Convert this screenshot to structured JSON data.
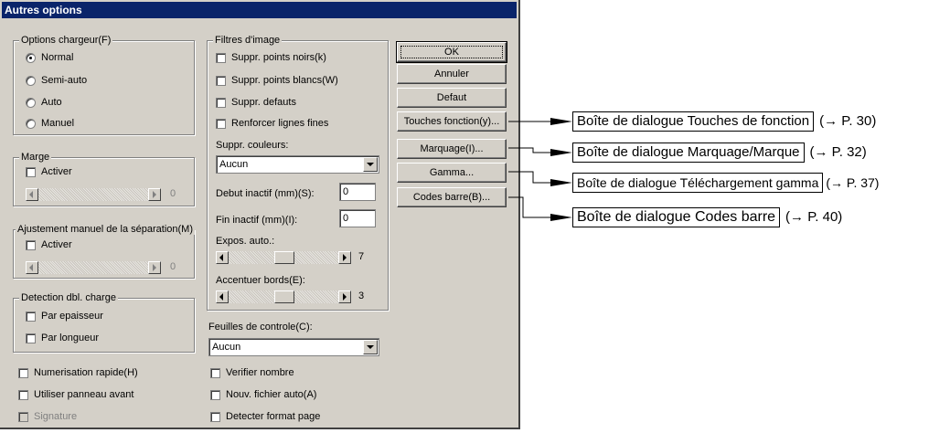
{
  "title": "Autres options",
  "loader": {
    "legend": "Options chargeur(F)",
    "options": [
      "Normal",
      "Semi-auto",
      "Auto",
      "Manuel"
    ],
    "selected": "Normal"
  },
  "margin": {
    "legend": "Marge",
    "enable": "Activer",
    "value": "0"
  },
  "separation": {
    "legend": "Ajustement manuel de la séparation(M)",
    "enable": "Activer",
    "value": "0"
  },
  "double_feed": {
    "legend": "Detection dbl. charge",
    "thickness": "Par epaisseur",
    "length": "Par longueur"
  },
  "left_checks": {
    "fast_scan": "Numerisation rapide(H)",
    "front_panel": "Utiliser panneau avant",
    "signature": "Signature"
  },
  "filters": {
    "legend": "Filtres d'image",
    "remove_black": "Suppr. points noirs(k)",
    "remove_white": "Suppr. points blancs(W)",
    "remove_defects": "Suppr. defauts",
    "reinforce_lines": "Renforcer lignes fines",
    "color_label": "Suppr. couleurs:",
    "color_value": "Aucun",
    "start_label": "Debut inactif (mm)(S):",
    "start_value": "0",
    "end_label": "Fin inactif (mm)(I):",
    "end_value": "0",
    "auto_exposure_label": "Expos. auto.:",
    "auto_exposure_value": "7",
    "edge_label": "Accentuer bords(E):",
    "edge_value": "3"
  },
  "control_sheets": {
    "label": "Feuilles de controle(C):",
    "value": "Aucun"
  },
  "right_checks": {
    "verify_count": "Verifier nombre",
    "auto_new_file": "Nouv. fichier auto(A)",
    "detect_page": "Detecter format page"
  },
  "buttons": {
    "ok": "OK",
    "cancel": "Annuler",
    "default": "Defaut",
    "function_keys": "Touches fonction(y)...",
    "imprinting": "Marquage(I)...",
    "gamma": "Gamma...",
    "barcodes": "Codes barre(B)..."
  },
  "annotations": [
    {
      "text": "Boîte de dialogue Touches de fonction",
      "ref": "(→ P. 30)"
    },
    {
      "text": "Boîte de dialogue Marquage/Marque",
      "ref": "(→ P. 32)"
    },
    {
      "text": "Boîte de dialogue Téléchargement gamma",
      "ref": "(→ P. 37)"
    },
    {
      "text": "Boîte de dialogue Codes barre",
      "ref": "(→ P. 40)"
    }
  ]
}
